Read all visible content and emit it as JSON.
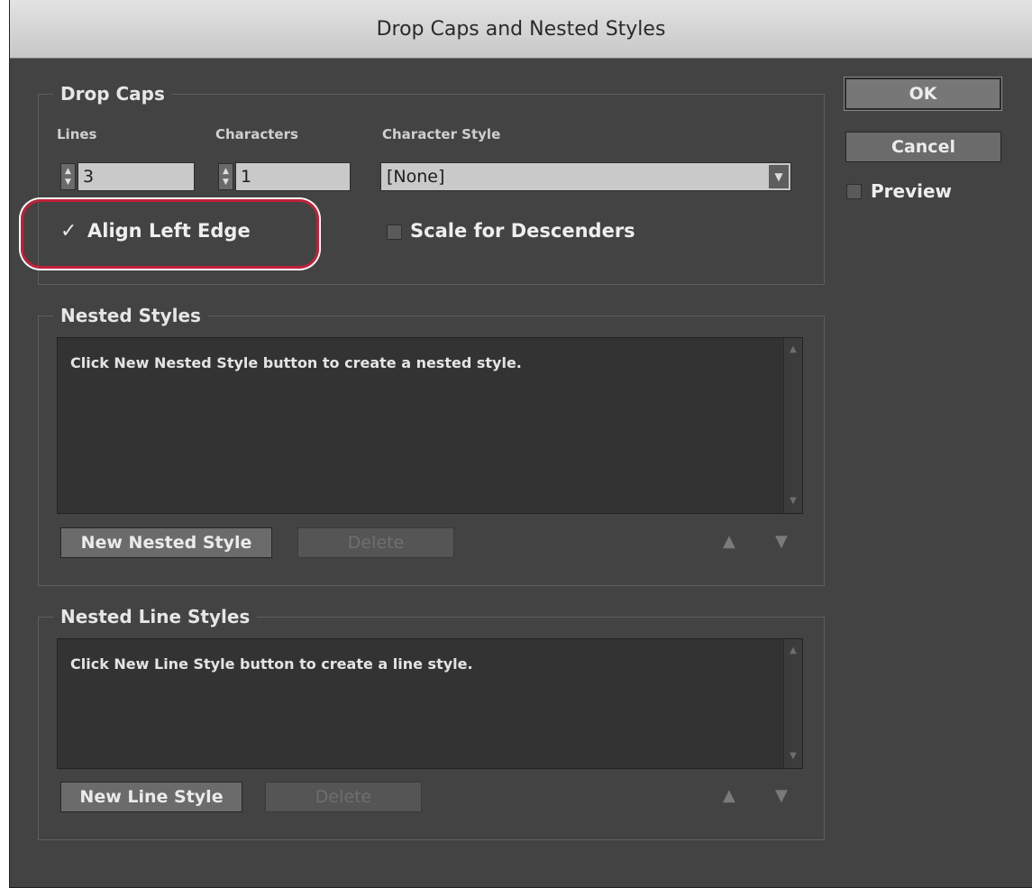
{
  "window": {
    "title": "Drop Caps and Nested Styles"
  },
  "drop_caps": {
    "legend": "Drop Caps",
    "lines_label": "Lines",
    "lines_value": "3",
    "characters_label": "Characters",
    "characters_value": "1",
    "character_style_label": "Character Style",
    "character_style_value": "[None]",
    "align_left_edge_label": "Align Left Edge",
    "align_left_edge_checked": true,
    "scale_descenders_label": "Scale for Descenders",
    "scale_descenders_checked": false
  },
  "nested_styles": {
    "legend": "Nested Styles",
    "placeholder": "Click New Nested Style button to create a nested style.",
    "new_button": "New Nested Style",
    "delete_button": "Delete"
  },
  "nested_line_styles": {
    "legend": "Nested Line Styles",
    "placeholder": "Click New Line Style button to create a line style.",
    "new_button": "New Line Style",
    "delete_button": "Delete"
  },
  "buttons": {
    "ok": "OK",
    "cancel": "Cancel"
  },
  "preview": {
    "label": "Preview",
    "checked": false
  },
  "icons": {
    "spinner": "spinner-icon",
    "dropdown": "chevron-down-icon",
    "move_up": "arrow-up-icon",
    "move_down": "arrow-down-icon",
    "check": "checkmark-icon"
  },
  "colors": {
    "dialog_bg": "#434343",
    "highlight": "#c1213a"
  }
}
